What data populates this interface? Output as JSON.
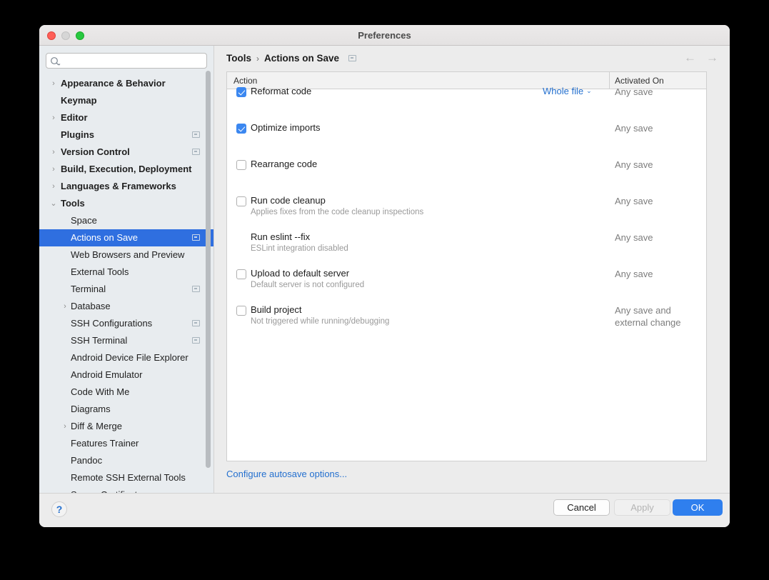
{
  "window": {
    "title": "Preferences",
    "traffic_lights": [
      "close-red",
      "minimize-gray",
      "zoom-green"
    ]
  },
  "sidebar": {
    "search": {
      "value": "",
      "placeholder": ""
    },
    "items": [
      {
        "label": "Appearance & Behavior",
        "type": "group",
        "arrow": "›",
        "badge": false,
        "selected": false
      },
      {
        "label": "Keymap",
        "type": "group",
        "arrow": "",
        "badge": false,
        "selected": false
      },
      {
        "label": "Editor",
        "type": "group",
        "arrow": "›",
        "badge": false,
        "selected": false
      },
      {
        "label": "Plugins",
        "type": "group",
        "arrow": "",
        "badge": true,
        "selected": false
      },
      {
        "label": "Version Control",
        "type": "group",
        "arrow": "›",
        "badge": true,
        "selected": false
      },
      {
        "label": "Build, Execution, Deployment",
        "type": "group",
        "arrow": "›",
        "badge": false,
        "selected": false
      },
      {
        "label": "Languages & Frameworks",
        "type": "group",
        "arrow": "›",
        "badge": false,
        "selected": false
      },
      {
        "label": "Tools",
        "type": "group",
        "arrow": "⌄",
        "badge": false,
        "selected": false
      },
      {
        "label": "Space",
        "type": "leaf",
        "arrow": "",
        "badge": false,
        "selected": false
      },
      {
        "label": "Actions on Save",
        "type": "leaf",
        "arrow": "",
        "badge": true,
        "selected": true
      },
      {
        "label": "Web Browsers and Preview",
        "type": "leaf",
        "arrow": "",
        "badge": false,
        "selected": false
      },
      {
        "label": "External Tools",
        "type": "leaf",
        "arrow": "",
        "badge": false,
        "selected": false
      },
      {
        "label": "Terminal",
        "type": "leaf",
        "arrow": "",
        "badge": true,
        "selected": false
      },
      {
        "label": "Database",
        "type": "leaf",
        "arrow": "›",
        "badge": false,
        "selected": false
      },
      {
        "label": "SSH Configurations",
        "type": "leaf",
        "arrow": "",
        "badge": true,
        "selected": false
      },
      {
        "label": "SSH Terminal",
        "type": "leaf",
        "arrow": "",
        "badge": true,
        "selected": false
      },
      {
        "label": "Android Device File Explorer",
        "type": "leaf",
        "arrow": "",
        "badge": false,
        "selected": false
      },
      {
        "label": "Android Emulator",
        "type": "leaf",
        "arrow": "",
        "badge": false,
        "selected": false
      },
      {
        "label": "Code With Me",
        "type": "leaf",
        "arrow": "",
        "badge": false,
        "selected": false
      },
      {
        "label": "Diagrams",
        "type": "leaf",
        "arrow": "",
        "badge": false,
        "selected": false
      },
      {
        "label": "Diff & Merge",
        "type": "leaf",
        "arrow": "›",
        "badge": false,
        "selected": false
      },
      {
        "label": "Features Trainer",
        "type": "leaf",
        "arrow": "",
        "badge": false,
        "selected": false
      },
      {
        "label": "Pandoc",
        "type": "leaf",
        "arrow": "",
        "badge": false,
        "selected": false
      },
      {
        "label": "Remote SSH External Tools",
        "type": "leaf",
        "arrow": "",
        "badge": false,
        "selected": false
      },
      {
        "label": "Server Certificates",
        "type": "leaf",
        "arrow": "",
        "badge": false,
        "selected": false
      }
    ]
  },
  "main": {
    "breadcrumb": {
      "parent": "Tools",
      "separator": "›",
      "current": "Actions on Save"
    },
    "nav": {
      "back": "←",
      "forward": "→"
    },
    "table": {
      "columns": [
        "Action",
        "Activated On"
      ],
      "rows": [
        {
          "label": "Reformat code",
          "sub": "",
          "checkbox": "checked",
          "combo": "Whole file",
          "combo_chevron": "⌄",
          "activated": "Any save"
        },
        {
          "label": "Optimize imports",
          "sub": "",
          "checkbox": "checked",
          "combo": "",
          "combo_chevron": "",
          "activated": "Any save"
        },
        {
          "label": "Rearrange code",
          "sub": "",
          "checkbox": "unchecked",
          "combo": "",
          "combo_chevron": "",
          "activated": "Any save"
        },
        {
          "label": "Run code cleanup",
          "sub": "Applies fixes from the code cleanup inspections",
          "checkbox": "unchecked",
          "combo": "",
          "combo_chevron": "",
          "activated": "Any save"
        },
        {
          "label": "Run eslint --fix",
          "sub": "ESLint integration disabled",
          "checkbox": "none",
          "combo": "",
          "combo_chevron": "",
          "activated": "Any save"
        },
        {
          "label": "Upload to default server",
          "sub": "Default server is not configured",
          "checkbox": "unchecked",
          "combo": "",
          "combo_chevron": "",
          "activated": "Any save"
        },
        {
          "label": "Build project",
          "sub": "Not triggered while running/debugging",
          "checkbox": "unchecked",
          "combo": "",
          "combo_chevron": "",
          "activated": "Any save and\nexternal change"
        }
      ]
    },
    "autosave_link": "Configure autosave options..."
  },
  "footer": {
    "help": "?",
    "cancel": "Cancel",
    "apply": "Apply",
    "ok": "OK"
  },
  "colors": {
    "accent_blue": "#2f7fee",
    "selection_blue": "#2f6fe0",
    "link_blue": "#2470cf",
    "checkbox_blue": "#3b87f0",
    "sidebar_bg": "#e8ecef",
    "panel_bg": "#ececec"
  }
}
